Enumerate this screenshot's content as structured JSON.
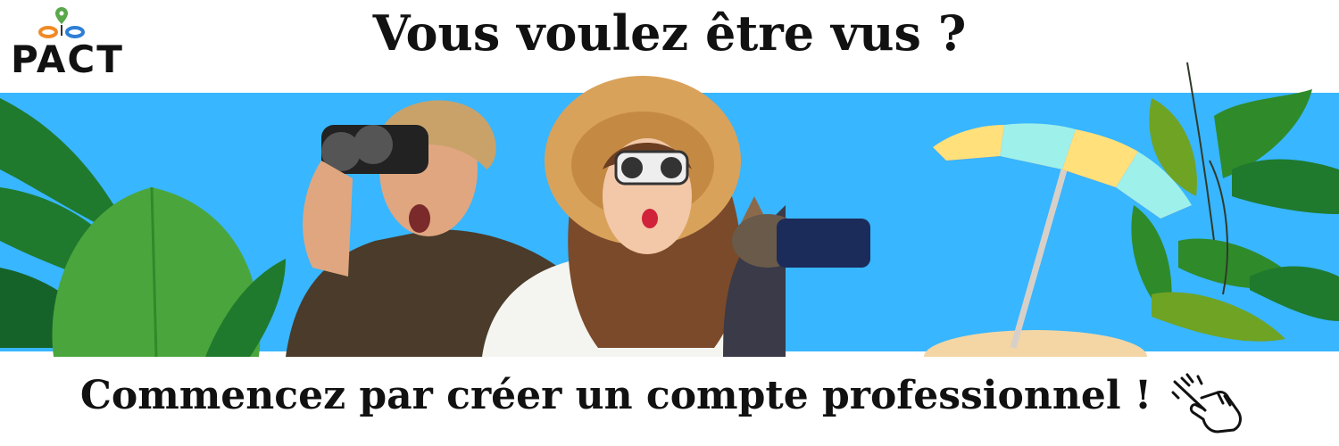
{
  "logo": {
    "text": "PACT",
    "icon": "map-pin-icon"
  },
  "headline": "Vous voulez être vus ?",
  "cta": {
    "text": "Commencez par créer un compte professionnel !",
    "icon": "pointing-hand-icon"
  },
  "colors": {
    "sky": "#38b6ff",
    "text": "#111111",
    "leaf_dark": "#1f7a2e",
    "leaf_light": "#4aa63c",
    "umbrella_red": "#f0616a",
    "umbrella_yellow": "#ffe07a",
    "umbrella_cyan": "#9ef0ea",
    "sand": "#f3d6a4"
  }
}
